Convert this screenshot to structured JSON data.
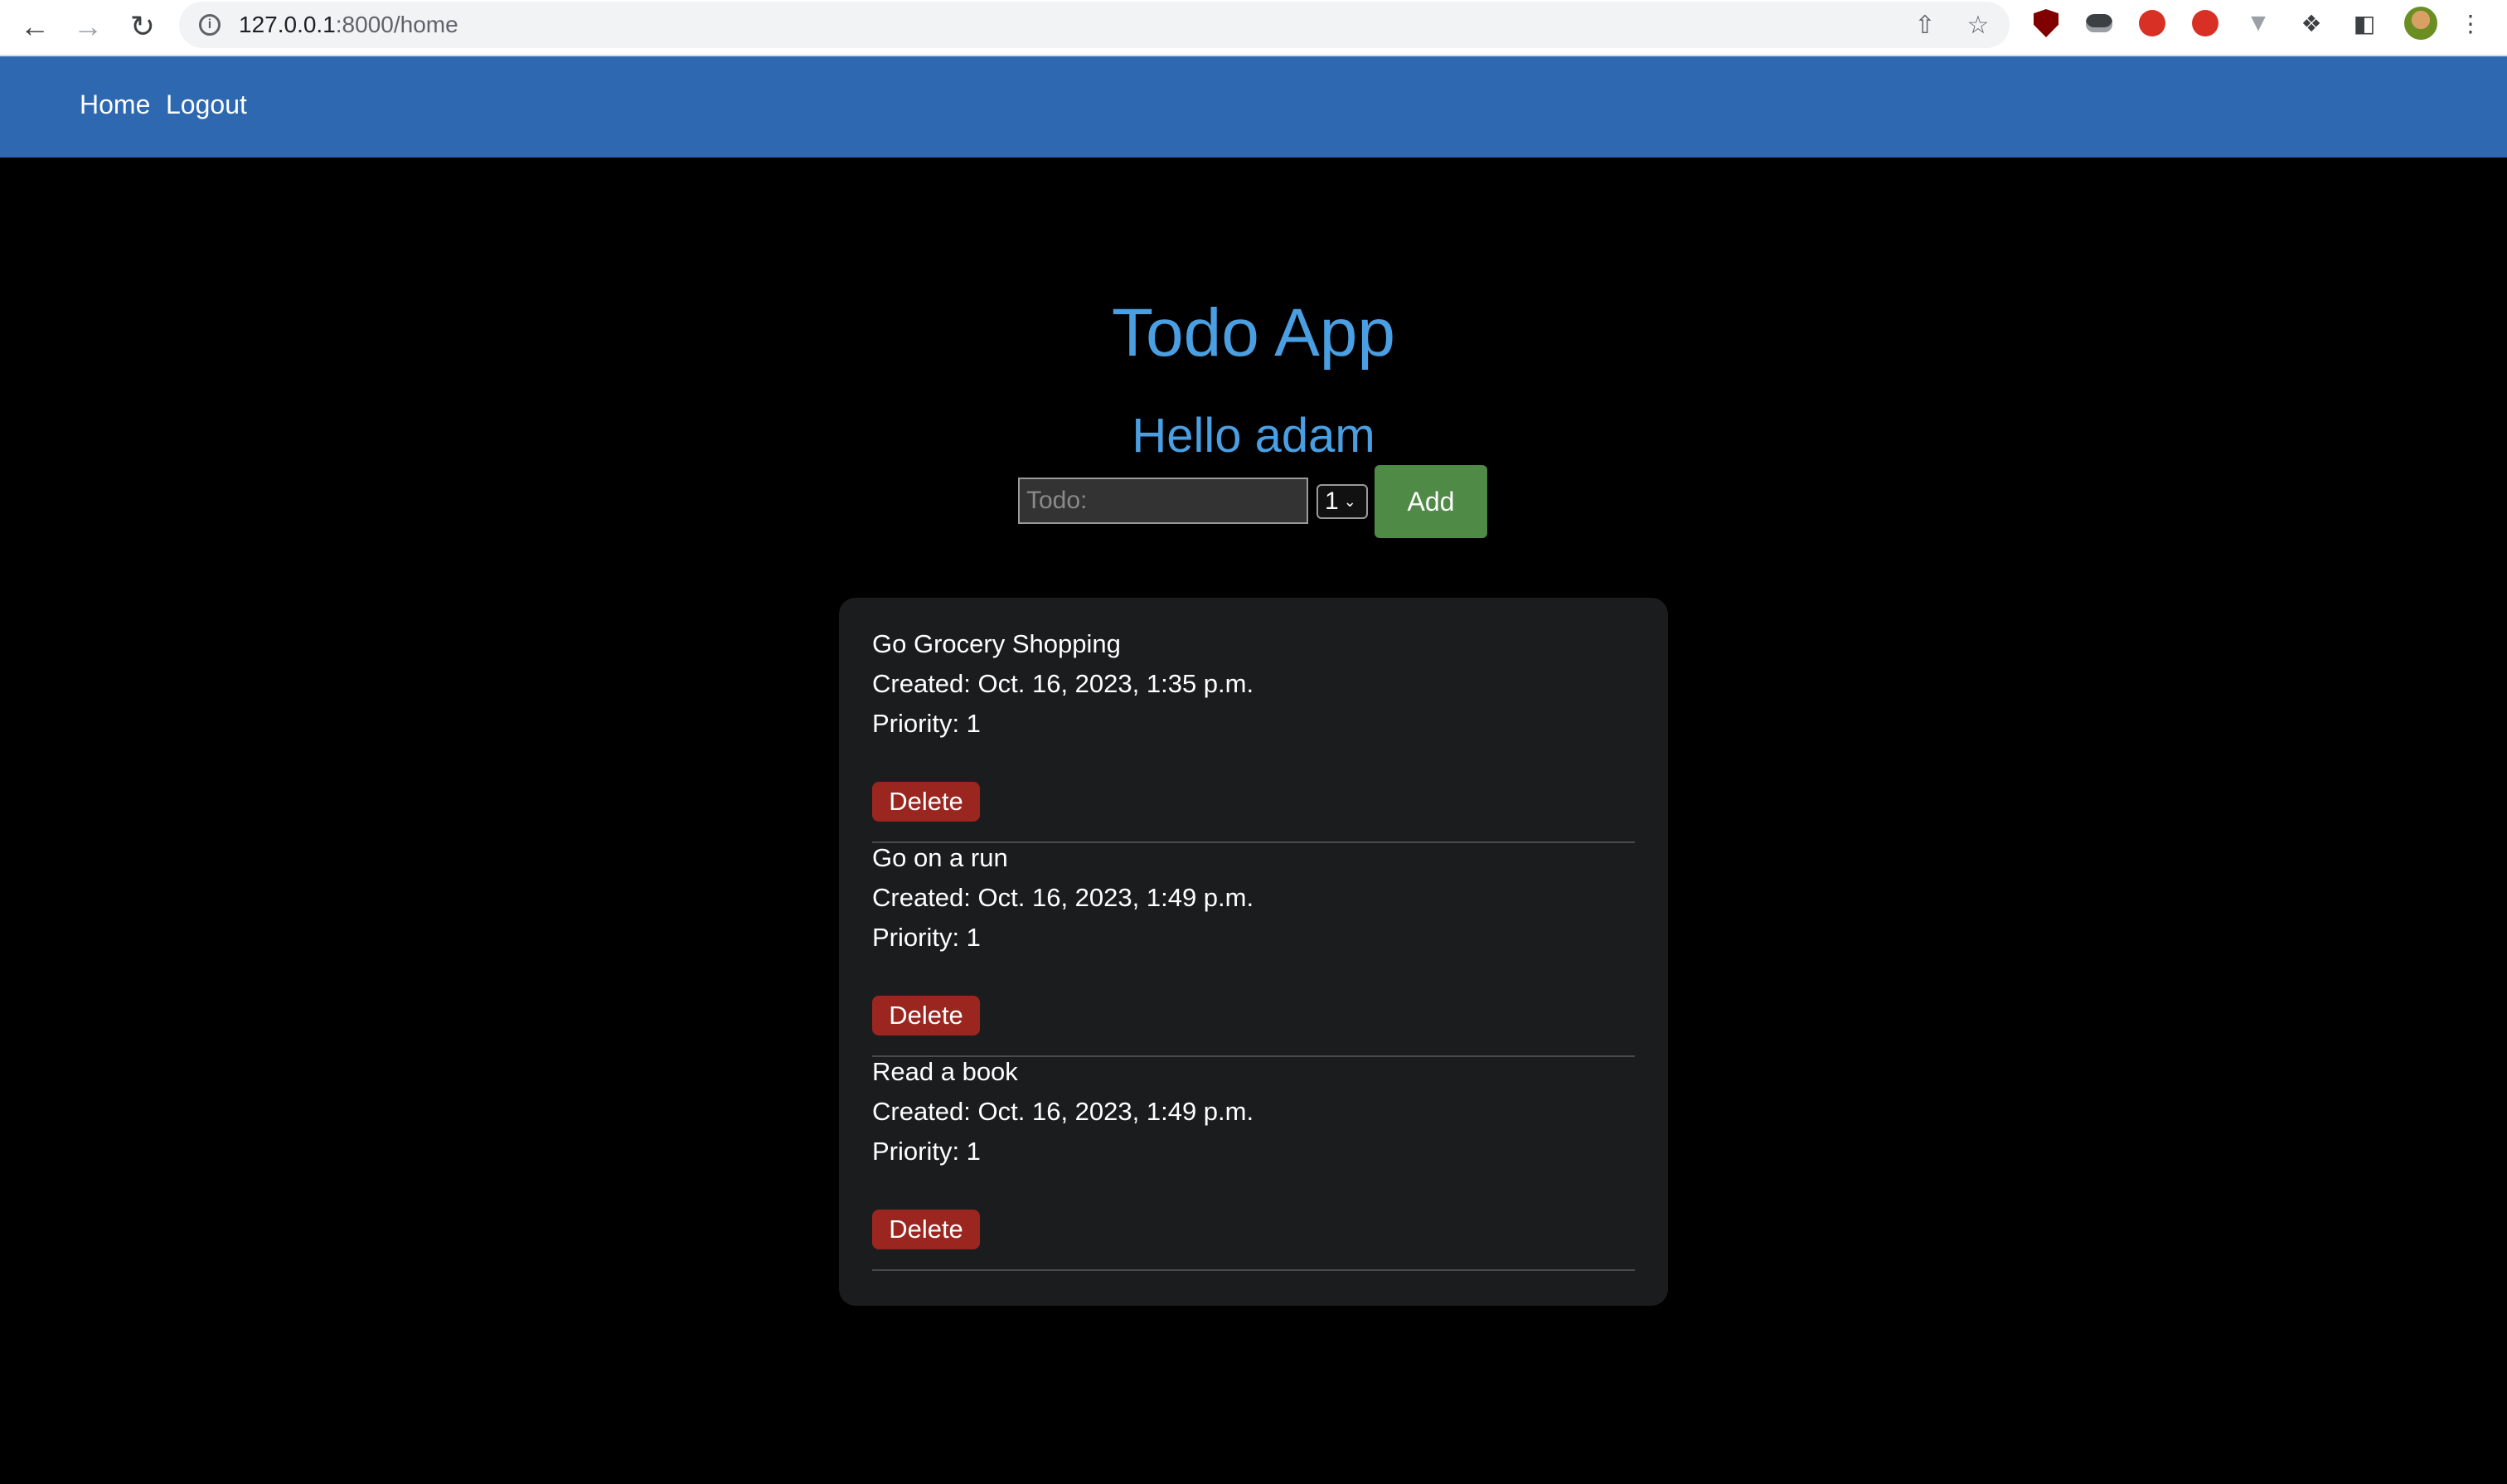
{
  "browser": {
    "url_host": "127.0.0.1",
    "url_path": ":8000/home"
  },
  "navbar": {
    "home_label": "Home",
    "logout_label": "Logout"
  },
  "main": {
    "title": "Todo App",
    "greeting": "Hello adam",
    "form": {
      "todo_placeholder": "Todo:",
      "priority_value": "1",
      "add_label": "Add"
    }
  },
  "todos": [
    {
      "title": "Go Grocery Shopping",
      "created": "Created: Oct. 16, 2023, 1:35 p.m.",
      "priority": "Priority: 1",
      "delete_label": "Delete"
    },
    {
      "title": "Go on a run",
      "created": "Created: Oct. 16, 2023, 1:49 p.m.",
      "priority": "Priority: 1",
      "delete_label": "Delete"
    },
    {
      "title": "Read a book",
      "created": "Created: Oct. 16, 2023, 1:49 p.m.",
      "priority": "Priority: 1",
      "delete_label": "Delete"
    }
  ],
  "colors": {
    "navbar": "#2d68b0",
    "heading": "#4a9fe3",
    "add_button": "#4f8a47",
    "delete_button": "#9b2620",
    "card": "#1b1c1e"
  }
}
